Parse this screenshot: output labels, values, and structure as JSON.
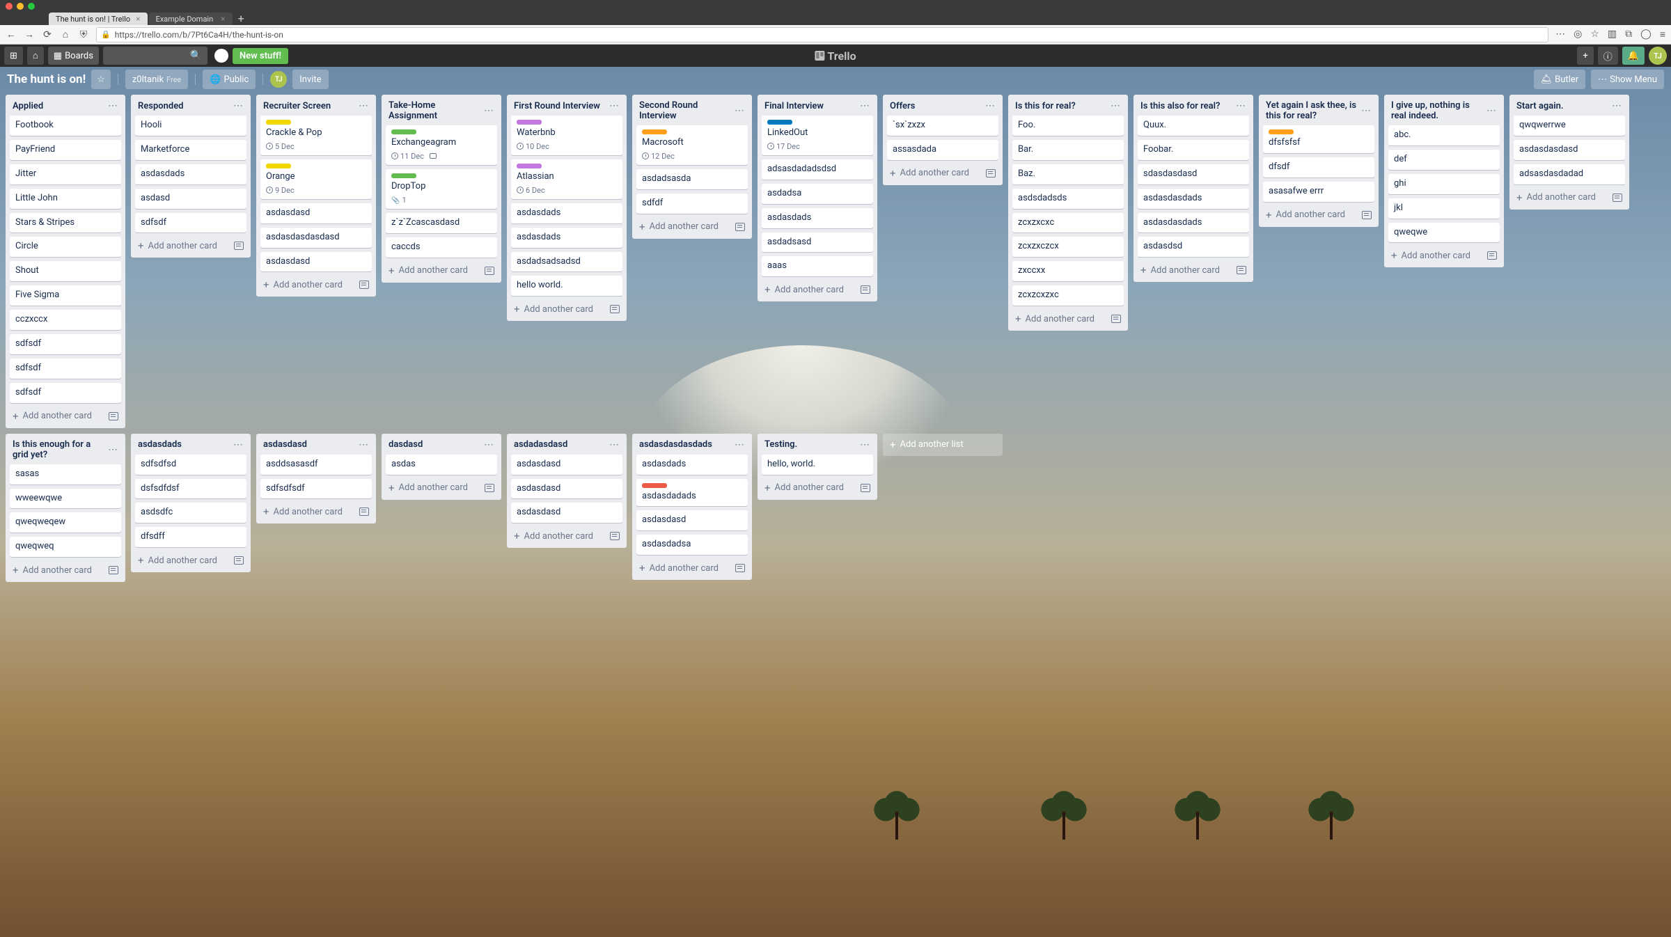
{
  "browser": {
    "tabs": [
      {
        "title": "The hunt is on! | Trello",
        "active": true
      },
      {
        "title": "Example Domain",
        "active": false
      }
    ],
    "url": "https://trello.com/b/7Pt6Ca4H/the-hunt-is-on"
  },
  "topbar": {
    "boards_label": "Boards",
    "new_stuff": "New stuff!",
    "logo_text": "Trello",
    "avatar_initials": "TJ"
  },
  "board_header": {
    "title": "The hunt is on!",
    "workspace": "z0ltanik",
    "workspace_plan": "Free",
    "visibility": "Public",
    "member_initials": "TJ",
    "invite": "Invite",
    "butler": "Butler",
    "show_menu": "Show Menu"
  },
  "add_another_card": "Add another card",
  "add_another_list": "Add another list",
  "lists": [
    {
      "name": "Applied",
      "cards": [
        {
          "title": "Footbook"
        },
        {
          "title": "PayFriend"
        },
        {
          "title": "Jitter"
        },
        {
          "title": "Little John"
        },
        {
          "title": "Stars & Stripes"
        },
        {
          "title": "Circle"
        },
        {
          "title": "Shout"
        },
        {
          "title": "Five Sigma"
        },
        {
          "title": "cczxccx"
        },
        {
          "title": "sdfsdf"
        },
        {
          "title": "sdfsdf"
        },
        {
          "title": "sdfsdf"
        }
      ]
    },
    {
      "name": "Responded",
      "cards": [
        {
          "title": "Hooli"
        },
        {
          "title": "Marketforce"
        },
        {
          "title": "asdasdads"
        },
        {
          "title": "asdasd"
        },
        {
          "title": "sdfsdf"
        }
      ]
    },
    {
      "name": "Recruiter Screen",
      "cards": [
        {
          "title": "Crackle & Pop",
          "label": "yellow",
          "due": "5 Dec"
        },
        {
          "title": "Orange",
          "label": "yellow",
          "due": "9 Dec"
        },
        {
          "title": "asdasdasd"
        },
        {
          "title": "asdasdasdasdasd"
        },
        {
          "title": "asdasdasd"
        }
      ]
    },
    {
      "name": "Take-Home Assignment",
      "cards": [
        {
          "title": "Exchangeagram",
          "label": "green",
          "due": "11 Dec",
          "comments": true
        },
        {
          "title": "DropTop",
          "label": "green",
          "attach": "1"
        },
        {
          "title": "z`z`Zcascasdasd"
        },
        {
          "title": "caccds"
        }
      ]
    },
    {
      "name": "First Round Interview",
      "cards": [
        {
          "title": "Waterbnb",
          "label": "purple",
          "due": "10 Dec"
        },
        {
          "title": "Atlassian",
          "label": "purple",
          "due": "6 Dec"
        },
        {
          "title": "asdasdads"
        },
        {
          "title": "asdasdads"
        },
        {
          "title": "asdadsadsadsd"
        },
        {
          "title": "hello world."
        }
      ]
    },
    {
      "name": "Second Round Interview",
      "cards": [
        {
          "title": "Macrosoft",
          "label": "orange",
          "due": "12 Dec"
        },
        {
          "title": "asdadsasda"
        },
        {
          "title": "sdfdf"
        }
      ]
    },
    {
      "name": "Final Interview",
      "cards": [
        {
          "title": "LinkedOut",
          "label": "blue",
          "due": "17 Dec"
        },
        {
          "title": "adsasdadadsdsd"
        },
        {
          "title": "asdadsa"
        },
        {
          "title": "asdasdads"
        },
        {
          "title": "asdadsasd"
        },
        {
          "title": "aaas"
        }
      ]
    },
    {
      "name": "Offers",
      "cards": [
        {
          "title": "`sx`zxzx"
        },
        {
          "title": "assasdada"
        }
      ]
    },
    {
      "name": "Is this for real?",
      "cards": [
        {
          "title": "Foo."
        },
        {
          "title": "Bar."
        },
        {
          "title": "Baz."
        },
        {
          "title": "asdsdadsds"
        },
        {
          "title": "zcxzxcxc"
        },
        {
          "title": "zcxzxczcx"
        },
        {
          "title": "zxccxx"
        },
        {
          "title": "zcxzcxzxc"
        }
      ]
    },
    {
      "name": "Is this also for real?",
      "cards": [
        {
          "title": "Quux."
        },
        {
          "title": "Foobar."
        },
        {
          "title": "sdasdasdasd"
        },
        {
          "title": "asdasdasdads"
        },
        {
          "title": "asdasdasdads"
        },
        {
          "title": "asdasdsd"
        }
      ]
    },
    {
      "name": "Yet again I ask thee, is this for real?",
      "cards": [
        {
          "title": "dfsfsfsf",
          "label": "orange"
        },
        {
          "title": "dfsdf"
        },
        {
          "title": "asasafwe errr"
        }
      ]
    },
    {
      "name": "I give up, nothing is real indeed.",
      "cards": [
        {
          "title": "abc."
        },
        {
          "title": "def"
        },
        {
          "title": "ghi"
        },
        {
          "title": "jkl"
        },
        {
          "title": "qweqwe"
        }
      ]
    },
    {
      "name": "Start again.",
      "cards": [
        {
          "title": "qwqwerrwe"
        },
        {
          "title": "asdasdasdasd"
        },
        {
          "title": "adsasdasdadad"
        }
      ]
    },
    {
      "name": "Is this enough for a grid yet?",
      "cards": [
        {
          "title": "sasas"
        },
        {
          "title": "wweewqwe"
        },
        {
          "title": "qweqweqew"
        },
        {
          "title": "qweqweq"
        }
      ]
    },
    {
      "name": "asdasdads",
      "cards": [
        {
          "title": "sdfsdfsd"
        },
        {
          "title": "dsfsdfdsf"
        },
        {
          "title": "asdsdfc"
        },
        {
          "title": "dfsdff"
        }
      ]
    },
    {
      "name": "asdasdasd",
      "cards": [
        {
          "title": "asddsasasdf"
        },
        {
          "title": "sdfsdfsdf"
        }
      ]
    },
    {
      "name": "dasdasd",
      "cards": [
        {
          "title": "asdas"
        }
      ]
    },
    {
      "name": "asdadasdasd",
      "cards": [
        {
          "title": "asdasdasd"
        },
        {
          "title": "asdasdasd"
        },
        {
          "title": "asdasdasd"
        }
      ]
    },
    {
      "name": "asdasdasdasdads",
      "cards": [
        {
          "title": "asdasdads"
        },
        {
          "title": "asdasdadads",
          "label": "red"
        },
        {
          "title": "asdasdasd"
        },
        {
          "title": "asdasdadsa"
        }
      ]
    },
    {
      "name": "Testing.",
      "cards": [
        {
          "title": "hello, world."
        }
      ]
    }
  ]
}
